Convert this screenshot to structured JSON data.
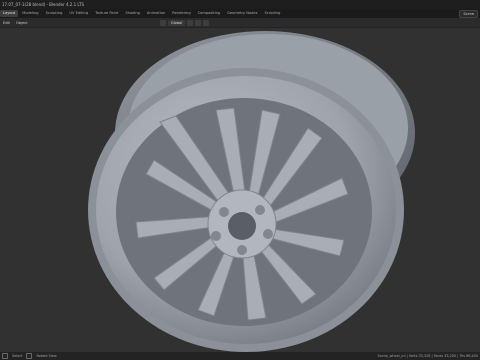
{
  "window": {
    "title": "17.07_07-1(28 blend) - Blender 4.2.1 LTS"
  },
  "workspaces": [
    "Layout",
    "Modeling",
    "Sculpting",
    "UV Editing",
    "Texture Paint",
    "Shading",
    "Animation",
    "Rendering",
    "Compositing",
    "Geometry Nodes",
    "Scripting"
  ],
  "header": {
    "menus": [
      "Edit",
      "Object"
    ]
  },
  "toolbar": {
    "orientation": "Global"
  },
  "scene": {
    "label": "Scene"
  },
  "viewport": {
    "mesh_color": "#a2a6ae"
  },
  "status": {
    "left_label": "Select",
    "mid_label": "Rotate View",
    "right_text": "Scene_wheel_mi | Verts 33,328 | Faces 33,200 | Tris 66,400"
  }
}
